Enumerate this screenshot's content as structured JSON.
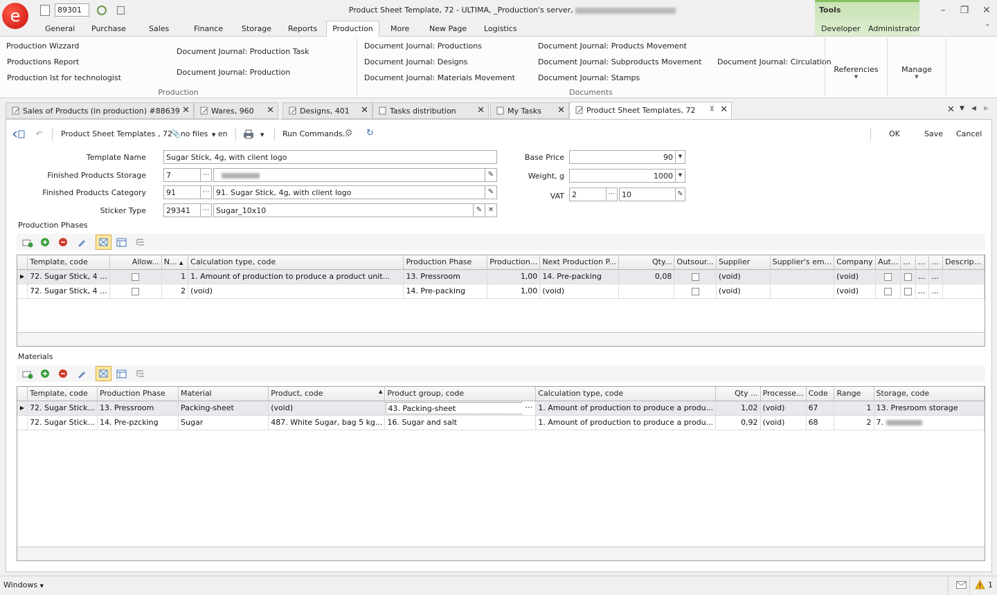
{
  "app": {
    "logo_letter": "e",
    "doc_number": "89301",
    "title": "Product Sheet Template, 72 - ULTIMA, _Production's server,",
    "tools_title": "Tools"
  },
  "menu": {
    "items": [
      "General",
      "Purchase",
      "Sales",
      "Finance",
      "Storage",
      "Reports",
      "Production",
      "More",
      "New Page",
      "Logistics"
    ],
    "active": "Production",
    "tools_items": [
      "Developer",
      "Administrator"
    ]
  },
  "ribbon": {
    "production": {
      "items": [
        "Production Wizzard",
        "Productions Report",
        "Production lst for technologist",
        "Document Journal: Production Task",
        "Document Journal: Production"
      ],
      "group_label": "Production"
    },
    "documents": {
      "items": [
        "Document Journal: Productions",
        "Document Journal: Designs",
        "Document Journal: Materials Movement",
        "Document Journal: Products Movement",
        "Document Journal: Subproducts Movement",
        "Document Journal: Stamps",
        "Document Journal: Circulation"
      ],
      "group_label": "Documents"
    },
    "references_label": "Referencies",
    "manage_label": "Manage"
  },
  "doc_tabs": [
    {
      "label": "Sales of Products (in production) #88639"
    },
    {
      "label": "Wares, 960"
    },
    {
      "label": "Designs, 401"
    },
    {
      "label": "Tasks distribution"
    },
    {
      "label": "My Tasks"
    },
    {
      "label": "Product Sheet Templates, 72",
      "active": true
    }
  ],
  "toolbar": {
    "breadcrumb": "Product Sheet Templates , 72",
    "files": "no files",
    "lang": "en",
    "run_commands": "Run Commands...",
    "ok": "OK",
    "save": "Save",
    "cancel": "Cancel"
  },
  "form": {
    "template_name_label": "Template Name",
    "template_name": "Sugar Stick, 4g, with client logo",
    "storage_label": "Finished Products Storage",
    "storage_code": "7",
    "category_label": "Finished Products Category",
    "category_code": "91",
    "category_name": "91. Sugar Stick, 4g, with client logo",
    "sticker_label": "Sticker Type",
    "sticker_code": "29341",
    "sticker_name": "Sugar_10x10",
    "base_price_label": "Base Price",
    "base_price": "90",
    "weight_label": "Weight, g",
    "weight": "1000",
    "vat_label": "VAT",
    "vat_code": "2",
    "vat_value": "10"
  },
  "phases": {
    "section_label": "Production Phases",
    "columns": [
      "Template, code",
      "Allow...",
      "N...",
      "Calculation type, code",
      "Production Phase",
      "Production...",
      "Next Production P...",
      "Qty...",
      "Outsour...",
      "Supplier",
      "Supplier's em...",
      "Company",
      "Aut...",
      "...",
      "...",
      "...",
      "Descrip..."
    ],
    "rows": [
      [
        "72. Sugar Stick, 4 ...",
        "",
        "1",
        "1. Amount of production to produce a product unit...",
        "13. Pressroom",
        "1,00",
        "14. Pre-packing",
        "0,08",
        "",
        "(void)",
        "",
        "(void)",
        "",
        "",
        "...",
        "...",
        ""
      ],
      [
        "72. Sugar Stick, 4 ...",
        "",
        "2",
        "(void)",
        "14. Pre-packing",
        "1,00",
        "(void)",
        "",
        "",
        "(void)",
        "",
        "(void)",
        "",
        "",
        "...",
        "...",
        ""
      ]
    ]
  },
  "materials": {
    "section_label": "Materials",
    "columns": [
      "Template, code",
      "Production Phase",
      "Material",
      "Product, code",
      "Product group, code",
      "Calculation type, code",
      "Qty ...",
      "Processe...",
      "Code",
      "Range",
      "Storage, code"
    ],
    "rows": [
      [
        "72. Sugar Stick...",
        "13. Pressroom",
        "Packing-sheet",
        "(void)",
        "43. Packing-sheet",
        "1. Amount of production to produce a produ...",
        "1,02",
        "(void)",
        "67",
        "1",
        "13. Presroom storage"
      ],
      [
        "72. Sugar Stick...",
        "14. Pre-pzcking",
        "Sugar",
        "487. White Sugar, bag 5 kg...",
        "16. Sugar and salt",
        "1. Amount of production to produce a produ...",
        "0,92",
        "(void)",
        "68",
        "2",
        "7."
      ]
    ]
  },
  "status": {
    "windows_label": "Windows",
    "alerts_count": "1"
  }
}
